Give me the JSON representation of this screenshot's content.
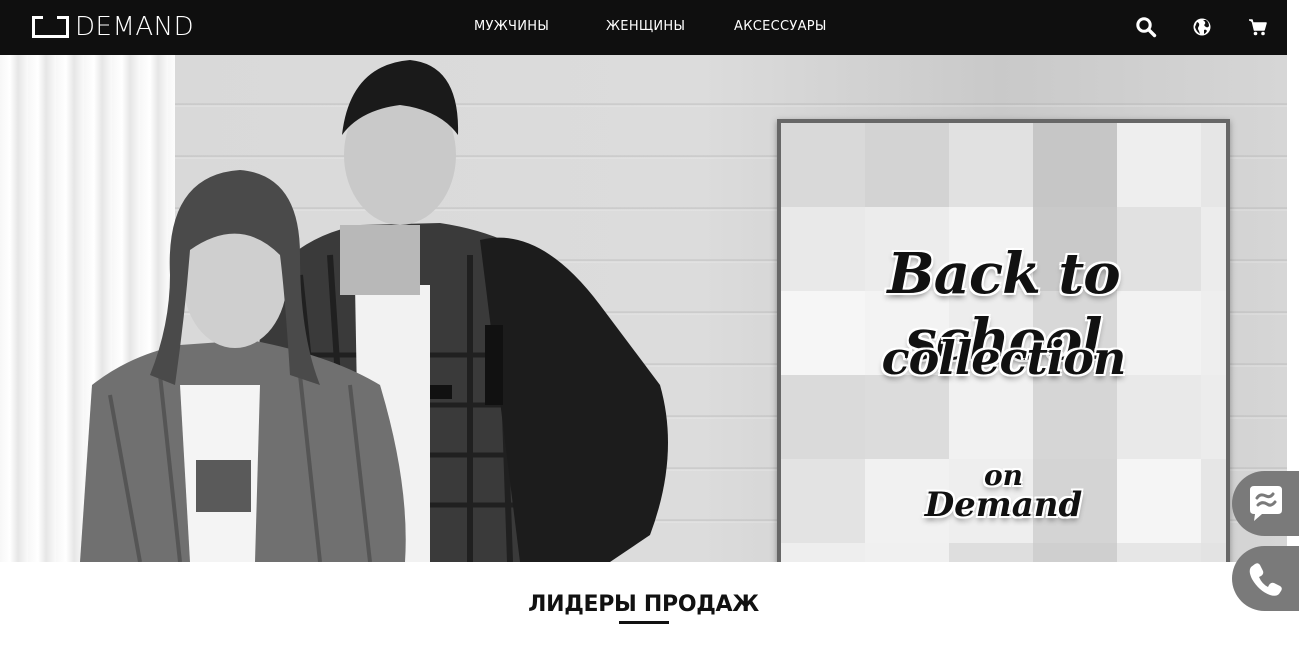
{
  "header": {
    "logo_text": "DEMAND",
    "nav": {
      "men": "МУЖЧИНЫ",
      "women": "ЖЕНЩИНЫ",
      "accessories": "АКСЕССУАРЫ"
    },
    "icons": [
      "search-icon",
      "globe-icon",
      "cart-icon"
    ]
  },
  "hero": {
    "image": "two-students-with-backpack-photo",
    "promo": {
      "line1": "Back to school",
      "line2": "collection",
      "line3": "on",
      "line4": "Demand"
    }
  },
  "floating": {
    "icons": [
      "chat-icon",
      "phone-icon"
    ]
  },
  "section": {
    "title": "ЛИДЕРЫ ПРОДАЖ"
  },
  "colors": {
    "header_bg": "#0f0f0f",
    "float_button_bg": "#7a7a7a",
    "promo_border": "#676767"
  }
}
